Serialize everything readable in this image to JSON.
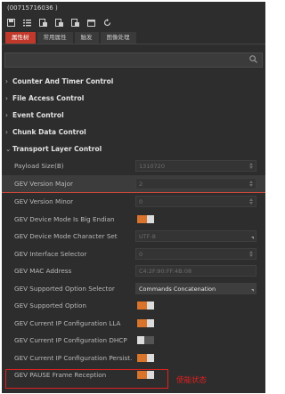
{
  "window": {
    "title": "(00715716036 )"
  },
  "tabs": [
    {
      "label": "属性树",
      "active": true
    },
    {
      "label": "常用属性",
      "active": false
    },
    {
      "label": "触发",
      "active": false
    },
    {
      "label": "图像处理",
      "active": false
    }
  ],
  "search": {
    "value": "",
    "placeholder": ""
  },
  "categories": {
    "counter": "Counter And Timer Control",
    "file": "File Access Control",
    "event": "Event Control",
    "chunk": "Chunk Data Control",
    "transport": "Transport Layer Control"
  },
  "rows": [
    {
      "name": "Payload Size(B)",
      "value": "1310720"
    },
    {
      "name": "GEV Version Major",
      "value": "2"
    },
    {
      "name": "GEV Version Minor",
      "value": "0"
    },
    {
      "name": "GEV Device Mode Is Big Endian",
      "toggle": "on"
    },
    {
      "name": "GEV Device Mode Character Set",
      "value": "UTF-8"
    },
    {
      "name": "GEV Interface Selector",
      "value": "0"
    },
    {
      "name": "GEV MAC Address",
      "value": "C4:2F:90:FF:4B:08"
    },
    {
      "name": "GEV Supported Option Selector",
      "value": "Commands Concatenation"
    },
    {
      "name": "GEV Supported Option",
      "toggle": "on"
    },
    {
      "name": "GEV Current IP Configuration LLA",
      "toggle": "on"
    },
    {
      "name": "GEV Current IP Configuration DHCP",
      "toggle": "off"
    },
    {
      "name": "GEV Current IP Configuration Persist...",
      "toggle": "on"
    },
    {
      "name": "GEV PAUSE Frame Reception",
      "toggle": "on"
    }
  ],
  "annotation": {
    "label": "使能状态",
    "color": "#e02020"
  },
  "colors": {
    "accent": "#c0392b",
    "toggle_on": "#d8742c",
    "panel_bg": "#2d2d2d"
  }
}
